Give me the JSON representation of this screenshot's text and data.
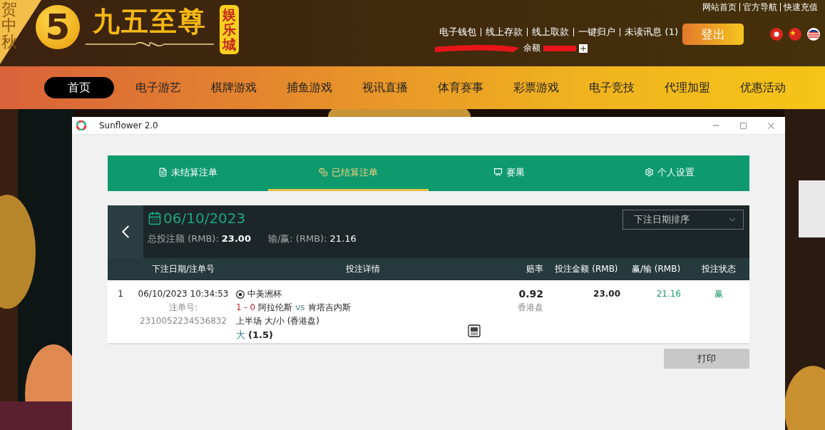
{
  "ribbon": {
    "text": "贺中秋"
  },
  "logo": {
    "mark": "5",
    "title": "九五至尊",
    "badge": "娱乐城"
  },
  "top_links": [
    "网站首页",
    "官方导航",
    "快速充值"
  ],
  "account_links": [
    "电子钱包",
    "线上存款",
    "线上取款",
    "一键归户",
    "未读讯息 (1)"
  ],
  "balance_label": "余额",
  "logout_button": "登出",
  "nav": [
    {
      "label": "首页",
      "selected": true
    },
    {
      "label": "电子游艺",
      "selected": false
    },
    {
      "label": "棋牌游戏",
      "selected": false
    },
    {
      "label": "捕鱼游戏",
      "selected": false
    },
    {
      "label": "视讯直播",
      "selected": false
    },
    {
      "label": "体育赛事",
      "selected": false
    },
    {
      "label": "彩票游戏",
      "selected": false
    },
    {
      "label": "电子竞技",
      "selected": false
    },
    {
      "label": "代理加盟",
      "selected": false
    },
    {
      "label": "优惠活动",
      "selected": false
    }
  ],
  "background": {
    "kind": "picture"
  },
  "window": {
    "title": "Sunflower 2.0",
    "tabs": [
      {
        "label": "未结算注单",
        "selected": false
      },
      {
        "label": "已结算注单",
        "selected": true
      },
      {
        "label": "赛果",
        "selected": false
      },
      {
        "label": "个人设置",
        "selected": false
      }
    ],
    "summary": {
      "date": "06/10/2023",
      "total_label": "总投注额 (RMB):",
      "total": "23.00",
      "winloss_label": "输/赢: (RMB):",
      "winloss": "21.16"
    },
    "sort_select": {
      "value": "下注日期排序"
    },
    "table": {
      "columns": [
        "下注日期/注单号",
        "投注详情",
        "赔率",
        "投注金额 (RMB)",
        "赢/输 (RMB)",
        "投注状态"
      ],
      "rows": [
        {
          "index": "1",
          "datetime": "06/10/2023 10:34:53",
          "ticket_label": "注单号:",
          "ticket": "2310052234536832",
          "league": "中美洲杯",
          "score": "1 - 0",
          "home": "阿拉伦斯",
          "vs": "vs",
          "away": "肯塔吉内斯",
          "market": "上半场 大/小 (香港盘)",
          "pick": "大",
          "line": "(1.5)",
          "odds": "0.92",
          "odds_type": "香港盘",
          "stake": "23.00",
          "winloss": "21.16",
          "status": "赢"
        }
      ]
    },
    "print_button": "打印"
  }
}
